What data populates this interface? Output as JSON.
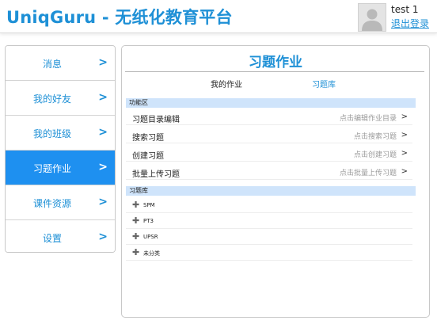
{
  "header": {
    "title": "UniqGuru - 无纸化教育平台",
    "username": "test 1",
    "logout_label": "退出登录"
  },
  "sidebar": {
    "items": [
      {
        "label": "消息",
        "active": false
      },
      {
        "label": "我的好友",
        "active": false
      },
      {
        "label": "我的班级",
        "active": false
      },
      {
        "label": "习题作业",
        "active": true
      },
      {
        "label": "课件资源",
        "active": false
      },
      {
        "label": "设置",
        "active": false
      }
    ],
    "chevron": ">"
  },
  "panel": {
    "title": "习题作业",
    "tabs": [
      {
        "label": "我的作业",
        "selected": false
      },
      {
        "label": "习题库",
        "selected": true
      }
    ],
    "function_section": {
      "label": "功能区",
      "rows": [
        {
          "name": "习题目录编辑",
          "hint": "点击编辑作业目录",
          "arrow": ">"
        },
        {
          "name": "搜索习题",
          "hint": "点击搜索习题",
          "arrow": ">"
        },
        {
          "name": "创建习题",
          "hint": "点击创建习题",
          "arrow": ">"
        },
        {
          "name": "批量上传习题",
          "hint": "点击批量上传习题",
          "arrow": ">"
        }
      ]
    },
    "bank_section": {
      "label": "习题库",
      "expand_symbol": "✚",
      "items": [
        {
          "name": "SPM"
        },
        {
          "name": "PT3"
        },
        {
          "name": "UPSR"
        },
        {
          "name": "未分类"
        }
      ]
    }
  },
  "colors": {
    "accent": "#1e90d6",
    "active_bg": "#1e90f0",
    "section_bg": "#cfe4fb",
    "hint": "#9a9a9a"
  },
  "icons": {
    "avatar": "user-avatar-icon",
    "chevron": "chevron-right-icon",
    "expand": "plus-icon"
  }
}
